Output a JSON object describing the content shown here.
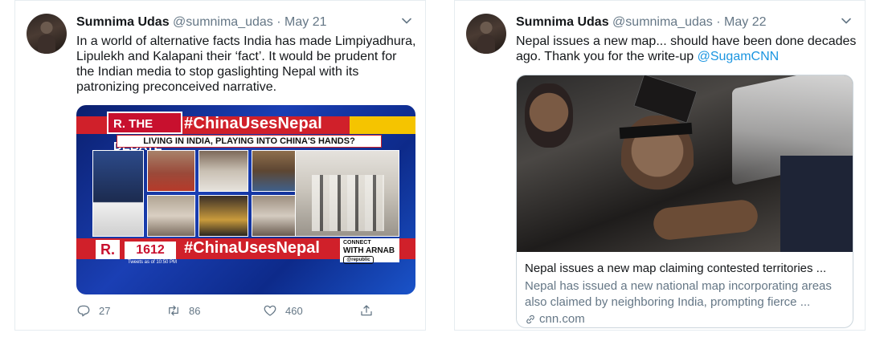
{
  "tweets": [
    {
      "name": "Sumnima Udas",
      "handle": "@sumnima_udas",
      "separator": "·",
      "date": "May 21",
      "text": "In a world of alternative facts India has made Limpiyadhura, Lipulekh and Kalapani their ‘fact’. It would be prudent for the Indian media to stop gaslighting Nepal with its patronizing preconceived narrative.",
      "media": {
        "logo": "R. THE DEBATE",
        "hashtag": "#ChinaUsesNepal",
        "subtitle": "LIVING IN INDIA, PLAYING INTO CHINA'S HANDS?",
        "r_mark": "R.",
        "tweet_count": "1612",
        "tweets_caption": "Tweets as of 10:50 PM",
        "hashtag_bottom": "#ChinaUsesNepal",
        "connect_line1": "CONNECT",
        "connect_line2": "WITH ARNAB",
        "connect_tag": "@republic"
      },
      "actions": {
        "replies": "27",
        "retweets": "86",
        "likes": "460"
      }
    },
    {
      "name": "Sumnima Udas",
      "handle": "@sumnima_udas",
      "separator": "·",
      "date": "May 22",
      "text_before": "Nepal issues a new map... should have been done decades ago. Thank you for the write-up ",
      "mention": "@SugamCNN",
      "card": {
        "title": "Nepal issues a new map claiming contested territories ...",
        "description": "Nepal has issued a new national map incorporating areas also claimed by neighboring India, prompting fierce ...",
        "domain": "cnn.com"
      }
    }
  ],
  "colors": {
    "link": "#1b95e0",
    "secondary_text": "#657786",
    "primary_text": "#14171a",
    "border": "#e6ecf0"
  },
  "icons": [
    "chevron-down-icon",
    "reply-icon",
    "retweet-icon",
    "like-icon",
    "share-icon",
    "link-icon"
  ]
}
